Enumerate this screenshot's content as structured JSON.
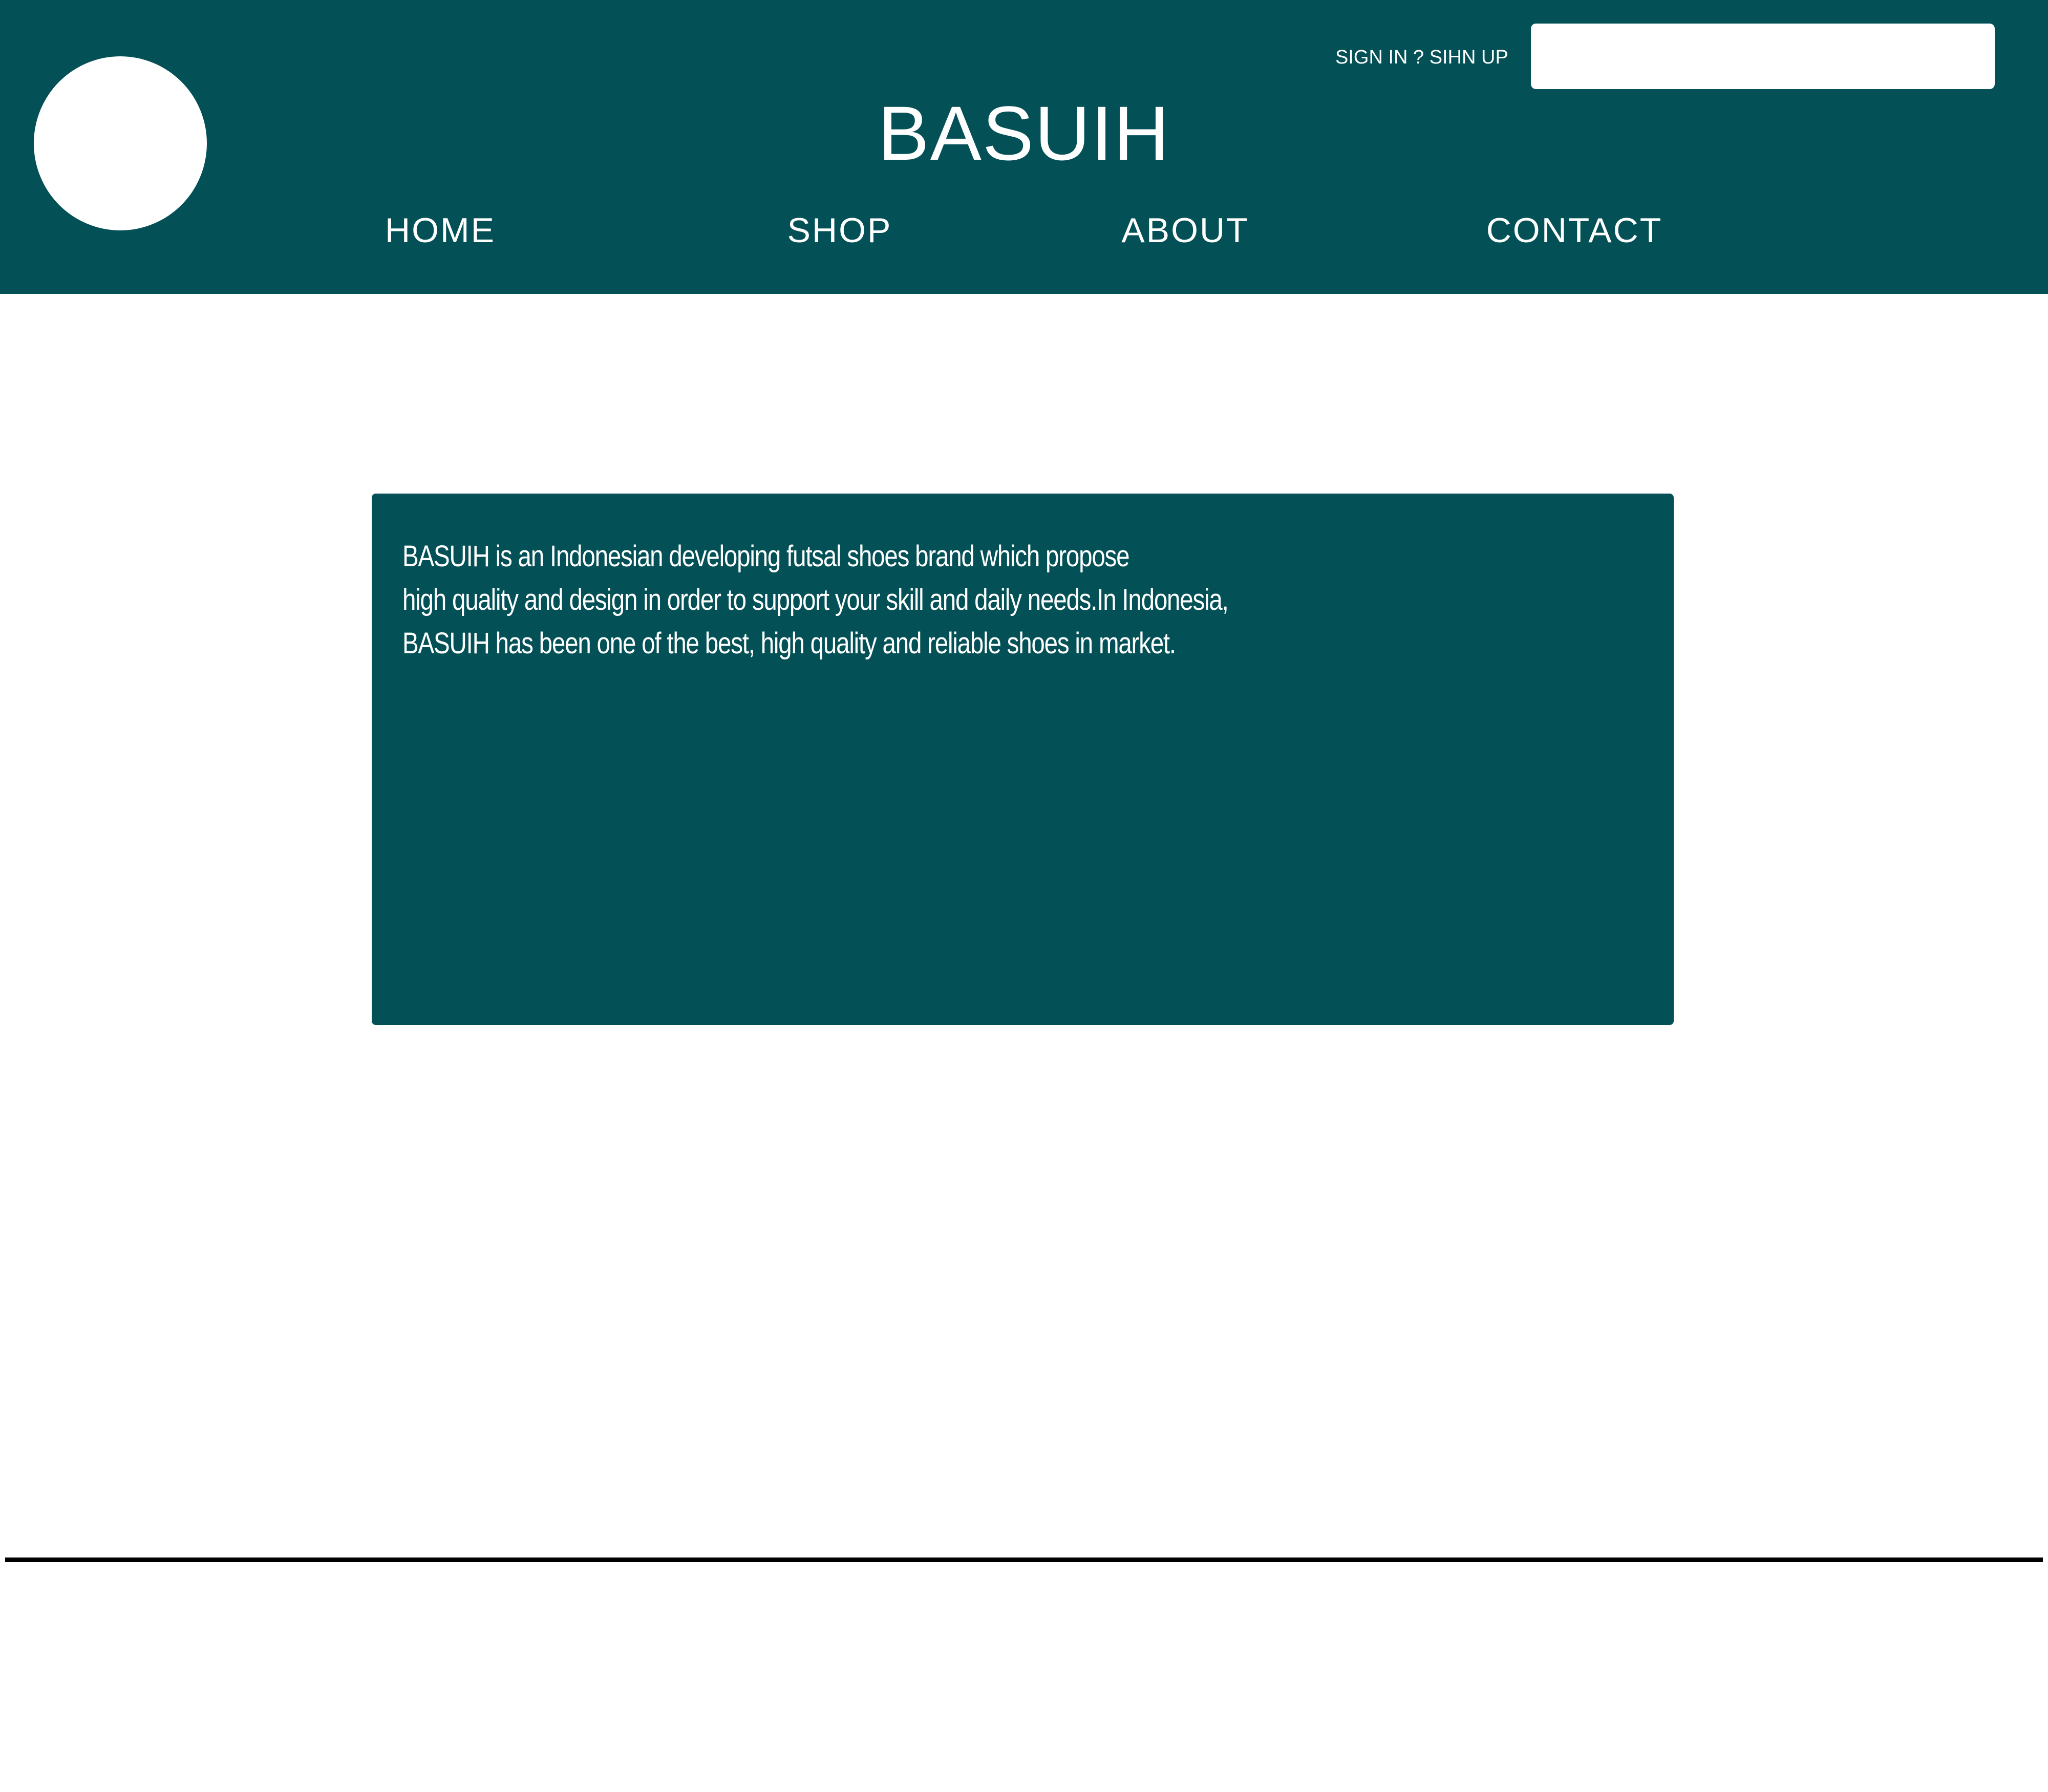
{
  "header": {
    "brand_title": "BASUIH",
    "auth_link": "SIGN IN ? SIHN UP",
    "search": {
      "value": "",
      "placeholder": ""
    },
    "nav": {
      "items": [
        {
          "label": "HOME"
        },
        {
          "label": "SHOP"
        },
        {
          "label": "ABOUT"
        },
        {
          "label": "CONTACT"
        }
      ]
    }
  },
  "main": {
    "about": {
      "lines": [
        "BASUIH is an Indonesian developing futsal shoes brand which propose",
        "high quality and design in order to support your skill and daily needs.In Indonesia,",
        "BASUIH has been one of the best, high quality and reliable shoes in market."
      ]
    }
  },
  "colors": {
    "brand_teal": "#035157",
    "background": "#ffffff",
    "text_on_brand": "#ffffff",
    "divider": "#000000"
  },
  "icons": {
    "logo": "logo-placeholder-circle"
  }
}
